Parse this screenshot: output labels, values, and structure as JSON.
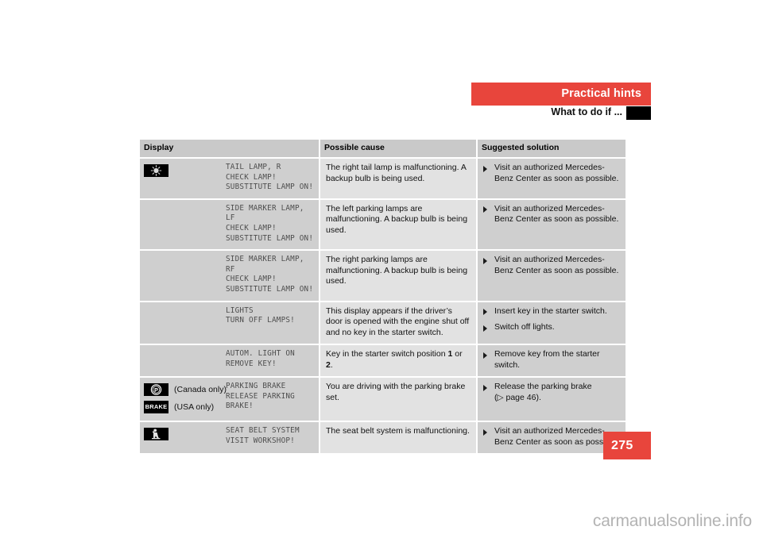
{
  "header": {
    "chapter_title": "Practical hints",
    "section_title": "What to do if ...",
    "chapter_color": "#e8453c",
    "marker_color": "#000000"
  },
  "table": {
    "columns": [
      {
        "key": "display",
        "label": "Display"
      },
      {
        "key": "cause",
        "label": "Possible cause"
      },
      {
        "key": "solution",
        "label": "Suggested solution"
      }
    ],
    "rows": [
      {
        "icons": [
          {
            "name": "lamp-warning-icon",
            "glyph": "lamp",
            "region_label": ""
          }
        ],
        "display_lines": [
          "TAIL LAMP, R",
          "CHECK LAMP!",
          "SUBSTITUTE LAMP ON!"
        ],
        "cause": "The right tail lamp is malfunctioning. A backup bulb is being used.",
        "solutions": [
          {
            "text": "Visit an authorized Mercedes-Benz Center as soon as possible."
          }
        ]
      },
      {
        "icons": [],
        "display_lines": [
          "SIDE MARKER LAMP, LF",
          "CHECK LAMP!",
          "SUBSTITUTE LAMP ON!"
        ],
        "cause": "The left parking lamps are malfunctioning. A backup bulb is being used.",
        "solutions": [
          {
            "text": "Visit an authorized Mercedes-Benz Center as soon as possible."
          }
        ]
      },
      {
        "icons": [],
        "display_lines": [
          "SIDE MARKER LAMP, RF",
          "CHECK LAMP!",
          "SUBSTITUTE LAMP ON!"
        ],
        "cause": "The right parking lamps are malfunctioning. A backup bulb is being used.",
        "solutions": [
          {
            "text": "Visit an authorized Mercedes-Benz Center as soon as possible."
          }
        ]
      },
      {
        "icons": [],
        "display_lines": [
          "LIGHTS",
          "TURN OFF LAMPS!"
        ],
        "cause": "This display appears if the driver’s door is opened with the engine shut off and no key in the starter switch.",
        "solutions": [
          {
            "text": "Insert key in the starter switch."
          },
          {
            "text": "Switch off lights."
          }
        ]
      },
      {
        "icons": [],
        "display_lines": [
          "AUTOM. LIGHT ON",
          "REMOVE KEY!"
        ],
        "cause_html": "Key in the starter switch position <b>1</b> or <b>2</b>.",
        "cause": "Key in the starter switch position 1 or 2.",
        "solutions": [
          {
            "text": "Remove key from the starter switch."
          }
        ]
      },
      {
        "icons": [
          {
            "name": "parking-brake-p-icon",
            "glyph": "parking-p",
            "region_label": "(Canada only)"
          },
          {
            "name": "brake-word-icon",
            "glyph": "brake-word",
            "region_label": "(USA only)"
          }
        ],
        "display_lines": [
          "PARKING BRAKE",
          "RELEASE PARKING BRAKE!"
        ],
        "cause": "You are driving with the parking brake set.",
        "solutions": [
          {
            "text": "Release the parking brake",
            "text2": "(▷ page 46)."
          }
        ]
      },
      {
        "icons": [
          {
            "name": "seat-belt-icon",
            "glyph": "seatbelt",
            "region_label": ""
          }
        ],
        "display_lines": [
          "SEAT BELT SYSTEM",
          "VISIT WORKSHOP!"
        ],
        "cause": "The seat belt system is malfunctioning.",
        "solutions": [
          {
            "text": "Visit an authorized Mercedes-Benz Center as soon as possible."
          }
        ]
      }
    ]
  },
  "footer": {
    "page_number": "275",
    "watermark": "carmanualsonline.info"
  }
}
